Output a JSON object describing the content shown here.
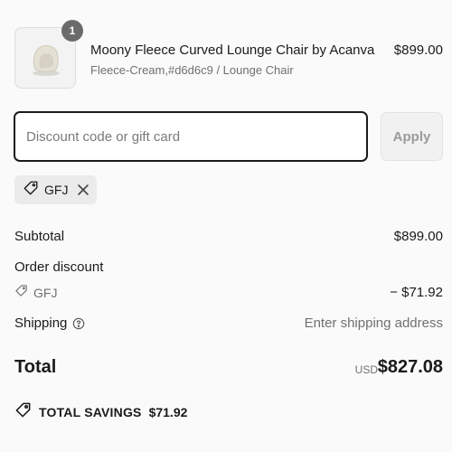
{
  "product": {
    "quantity": "1",
    "name": "Moony Fleece Curved Lounge Chair by Acanva",
    "variant": "Fleece-Cream,#d6d6c9 / Lounge Chair",
    "price": "$899.00",
    "thumbnail_icon": "lounge-chair-image"
  },
  "discount": {
    "placeholder": "Discount code or gift card",
    "value": "",
    "apply_label": "Apply",
    "applied_code": "GFJ"
  },
  "summary": {
    "subtotal_label": "Subtotal",
    "subtotal_value": "$899.00",
    "order_discount_label": "Order discount",
    "discount_code": "GFJ",
    "discount_value": "− $71.92",
    "shipping_label": "Shipping",
    "shipping_value": "Enter shipping address",
    "total_label": "Total",
    "currency": "USD",
    "total_value": "$827.08",
    "savings_label": "TOTAL SAVINGS",
    "savings_value": "$71.92"
  },
  "colors": {
    "text": "#1a1a1a",
    "muted": "#707070",
    "badge": "#6b6b6b",
    "chip_bg": "#ebebeb",
    "background": "#fafafa"
  }
}
